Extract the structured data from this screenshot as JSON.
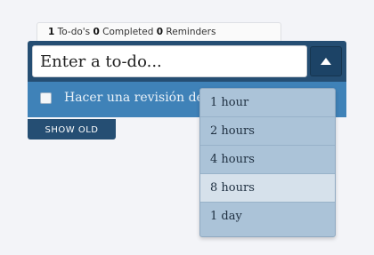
{
  "stats": {
    "todo_count": "1",
    "todo_label": "To-do's",
    "completed_count": "0",
    "completed_label": "Completed",
    "reminders_count": "0",
    "reminders_label": "Reminders"
  },
  "input": {
    "placeholder": "Enter a to-do..."
  },
  "toggle": {
    "icon": "triangle-up-icon"
  },
  "task": {
    "text": "Hacer una revisión de D",
    "checked": false,
    "icon": "clock-icon"
  },
  "show_old": {
    "label": "SHOW OLD"
  },
  "reminder_dropdown": {
    "options": [
      "1 hour",
      "2 hours",
      "4 hours",
      "8 hours",
      "1 day"
    ],
    "highlighted": "8 hours"
  },
  "colors": {
    "header": "#254e73",
    "task_row": "#3f82b8",
    "dropdown": "#abc3d8",
    "highlight": "#d6e1eb"
  }
}
